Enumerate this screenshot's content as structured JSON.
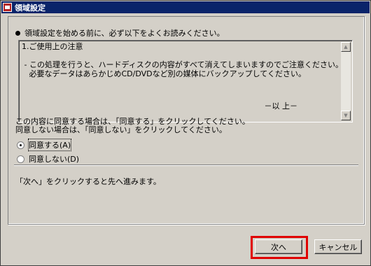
{
  "window": {
    "title": "領域設定"
  },
  "intro": "領域設定を始める前に、必ず以下をよくお読みください。",
  "notice": {
    "lines": [
      "1.ご使用上の注意",
      "",
      " - この処理を行うと、ハードディスクの内容がすべて消えてしまいますのでご注意ください。",
      "   必要なデータはあらかじめCD/DVDなど別の媒体にバックアップしてください。"
    ],
    "closing": "－以 上－"
  },
  "agree_instructions": {
    "line1": "この内容に同意する場合は、「同意する」をクリックしてください。",
    "line2": "同意しない場合は、「同意しない」をクリックしてください。"
  },
  "options": [
    {
      "label": "同意する(A)",
      "checked": true
    },
    {
      "label": "同意しない(D)",
      "checked": false
    }
  ],
  "next_hint": "「次へ」をクリックすると先へ進みます。",
  "buttons": {
    "next": "次へ",
    "cancel": "キャンセル"
  },
  "colors": {
    "titlebar": "#0a246a",
    "highlight": "#e00000",
    "face": "#d4d0c8"
  }
}
